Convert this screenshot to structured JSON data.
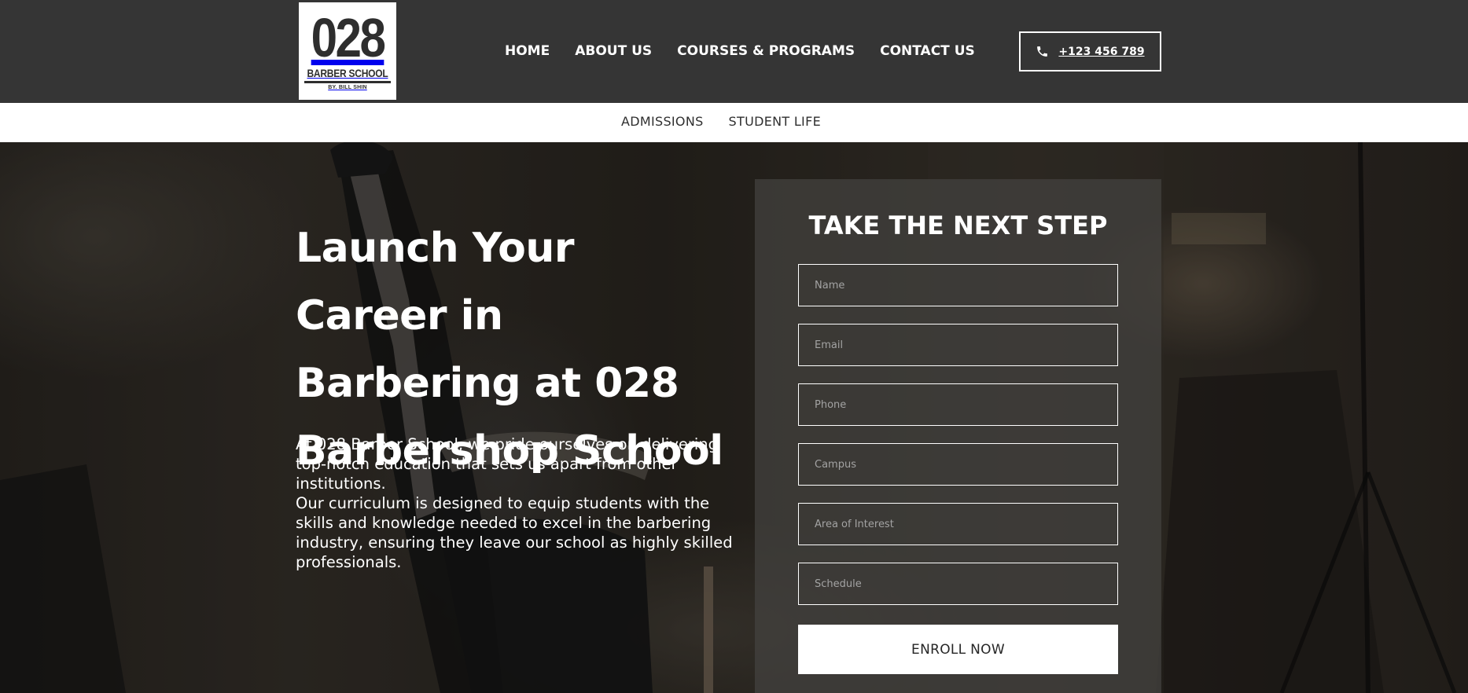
{
  "brand": {
    "logo_number": "028",
    "logo_name": "BARBER SCHOOL",
    "logo_byline": "BY. BILL SHIN"
  },
  "nav": {
    "items": [
      {
        "label": "HOME"
      },
      {
        "label": "ABOUT US"
      },
      {
        "label": "COURSES & PROGRAMS"
      },
      {
        "label": "CONTACT US"
      }
    ],
    "phone": {
      "label": "+123 456 789",
      "icon": "phone-icon"
    }
  },
  "subnav": {
    "items": [
      {
        "label": "ADMISSIONS"
      },
      {
        "label": "STUDENT LIFE"
      }
    ]
  },
  "hero": {
    "title": "Launch Your Career in Barbering at 028 Barbershop School",
    "paragraph1": "At 028 Barber School, we pride ourselves on delivering top-notch education that sets us apart from other institutions.",
    "paragraph2": "Our curriculum is designed to equip students with the skills and knowledge needed to excel in the barbering industry, ensuring they leave our school as highly skilled professionals."
  },
  "form": {
    "title": "TAKE THE NEXT STEP",
    "fields": [
      {
        "placeholder": "Name",
        "value": ""
      },
      {
        "placeholder": "Email",
        "value": ""
      },
      {
        "placeholder": "Phone",
        "value": ""
      },
      {
        "placeholder": "Campus",
        "value": ""
      },
      {
        "placeholder": "Area of Interest",
        "value": ""
      },
      {
        "placeholder": "Schedule",
        "value": ""
      }
    ],
    "submit_label": "ENROLL NOW"
  },
  "colors": {
    "header_bg": "#353535",
    "subnav_bg": "#ffffff",
    "text_light": "#ffffff",
    "button_bg": "#ffffff"
  }
}
